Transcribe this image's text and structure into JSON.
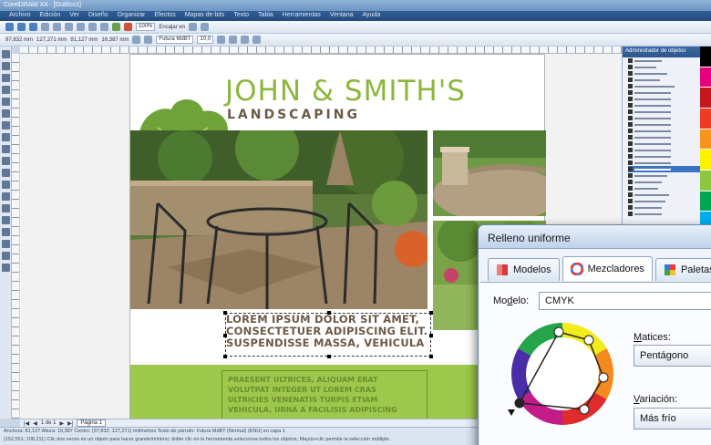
{
  "window": {
    "title": "CorelDRAW X4 - [Gráfico1]"
  },
  "menubar": [
    "Archivo",
    "Edición",
    "Ver",
    "Diseño",
    "Organizar",
    "Efectos",
    "Mapas de bits",
    "Texto",
    "Tabla",
    "Herramientas",
    "Ventana",
    "Ayuda"
  ],
  "toolbar": {
    "zoom": "100%",
    "snap": "Encajar en",
    "pos_x": "97,832 mm",
    "pos_y": "127,271 mm",
    "size_w": "81,127 mm",
    "size_h": "16,387 mm",
    "font": "Futura MdBT",
    "font_size": "10,0"
  },
  "document": {
    "title_main": "JOHN & SMITH'S",
    "title_sub": "LANDSCAPING",
    "lorem_lines": [
      "LOREM IPSUM DOLOR SIT AMET,",
      "CONSECTETUER ADIPISCING ELIT.",
      "SUSPENDISSE MASSA, VEHICULA"
    ],
    "band_lines": [
      "PRAESENT ULTRICES, ALIQUAM ERAT",
      "VOLUTPAT INTEGER UT LOREM CRAS",
      "ULTRICIES VENENATIS TURPIS ETIAM",
      "VEHICULA, URNA A FACILISIS ADIPISCING"
    ]
  },
  "docker": {
    "title": "Administrador de objetos"
  },
  "pagebar": {
    "counter": "1 de 1",
    "page_tab": "Página 1"
  },
  "statusbar": {
    "line1": "Anchura: 81,127 Altura: 16,387 Centro: (97,832; 127,271) milímetros      Texto de párrafo: Futura MdBT (Normal) (ENU) en capa 1",
    "line2": "(152,551; 108,211)   Clic dos veces en un objeto para hacer grande/mínimo; doble clic en la herramienta selecciona todos los objetos; Mayús+clic permite la selección múltiple..."
  },
  "dialog": {
    "title": "Relleno uniforme",
    "tabs": [
      {
        "label": "Modelos",
        "icon": "models-icon"
      },
      {
        "label": "Mezcladores",
        "icon": "mixers-icon"
      },
      {
        "label": "Paletas",
        "icon": "palettes-icon"
      }
    ],
    "active_tab": "Mezcladores",
    "model_label_pre": "Mo",
    "model_label_u": "d",
    "model_label_post": "elo:",
    "model_value": "CMYK",
    "hues_label_u": "M",
    "hues_label_post": "atices:",
    "hues_value": "Pentágono",
    "variation_label_u": "V",
    "variation_label_post": "ariación:",
    "variation_value": "Más frío"
  },
  "colors": {
    "brand_green": "#8db63c",
    "brand_brown": "#6c5a46",
    "band_green": "#9cc94b"
  }
}
